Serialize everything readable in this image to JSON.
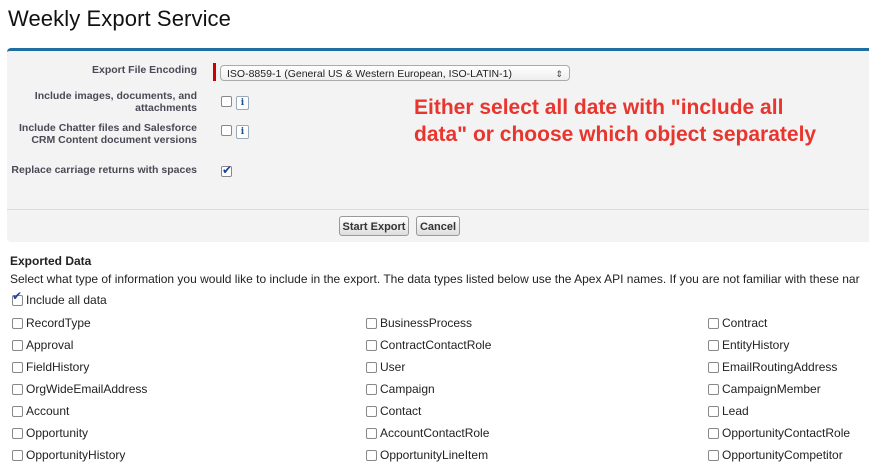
{
  "page_title": "Weekly Export Service",
  "form": {
    "encoding_label": "Export File Encoding",
    "encoding_value": "ISO-8859-1 (General US & Western European, ISO-LATIN-1)",
    "include_images_label": "Include images, documents, and attachments",
    "include_chatter_label": "Include Chatter files and Salesforce CRM Content document versions",
    "replace_returns_label": "Replace carriage returns with spaces",
    "include_images_checked": false,
    "include_chatter_checked": false,
    "replace_returns_checked": true,
    "info_glyph": "i"
  },
  "annotation": "Either select all date with \"include all data\" or choose which object separately",
  "buttons": {
    "start_export": "Start Export",
    "cancel": "Cancel"
  },
  "exported": {
    "title": "Exported Data",
    "description": "Select what type of information you would like to include in the export. The data types listed below use the Apex API names. If you are not familiar with these nar",
    "include_all_label": "Include all data",
    "include_all_checked": true,
    "items": [
      [
        "RecordType",
        "BusinessProcess",
        "Contract"
      ],
      [
        "Approval",
        "ContractContactRole",
        "EntityHistory"
      ],
      [
        "FieldHistory",
        "User",
        "EmailRoutingAddress"
      ],
      [
        "OrgWideEmailAddress",
        "Campaign",
        "CampaignMember"
      ],
      [
        "Account",
        "Contact",
        "Lead"
      ],
      [
        "Opportunity",
        "AccountContactRole",
        "OpportunityContactRole"
      ],
      [
        "OpportunityHistory",
        "OpportunityLineItem",
        "OpportunityCompetitor"
      ]
    ]
  },
  "colors": {
    "accent": "#1f6ea1",
    "required": "#cc0000",
    "annotation": "#e8352e"
  }
}
